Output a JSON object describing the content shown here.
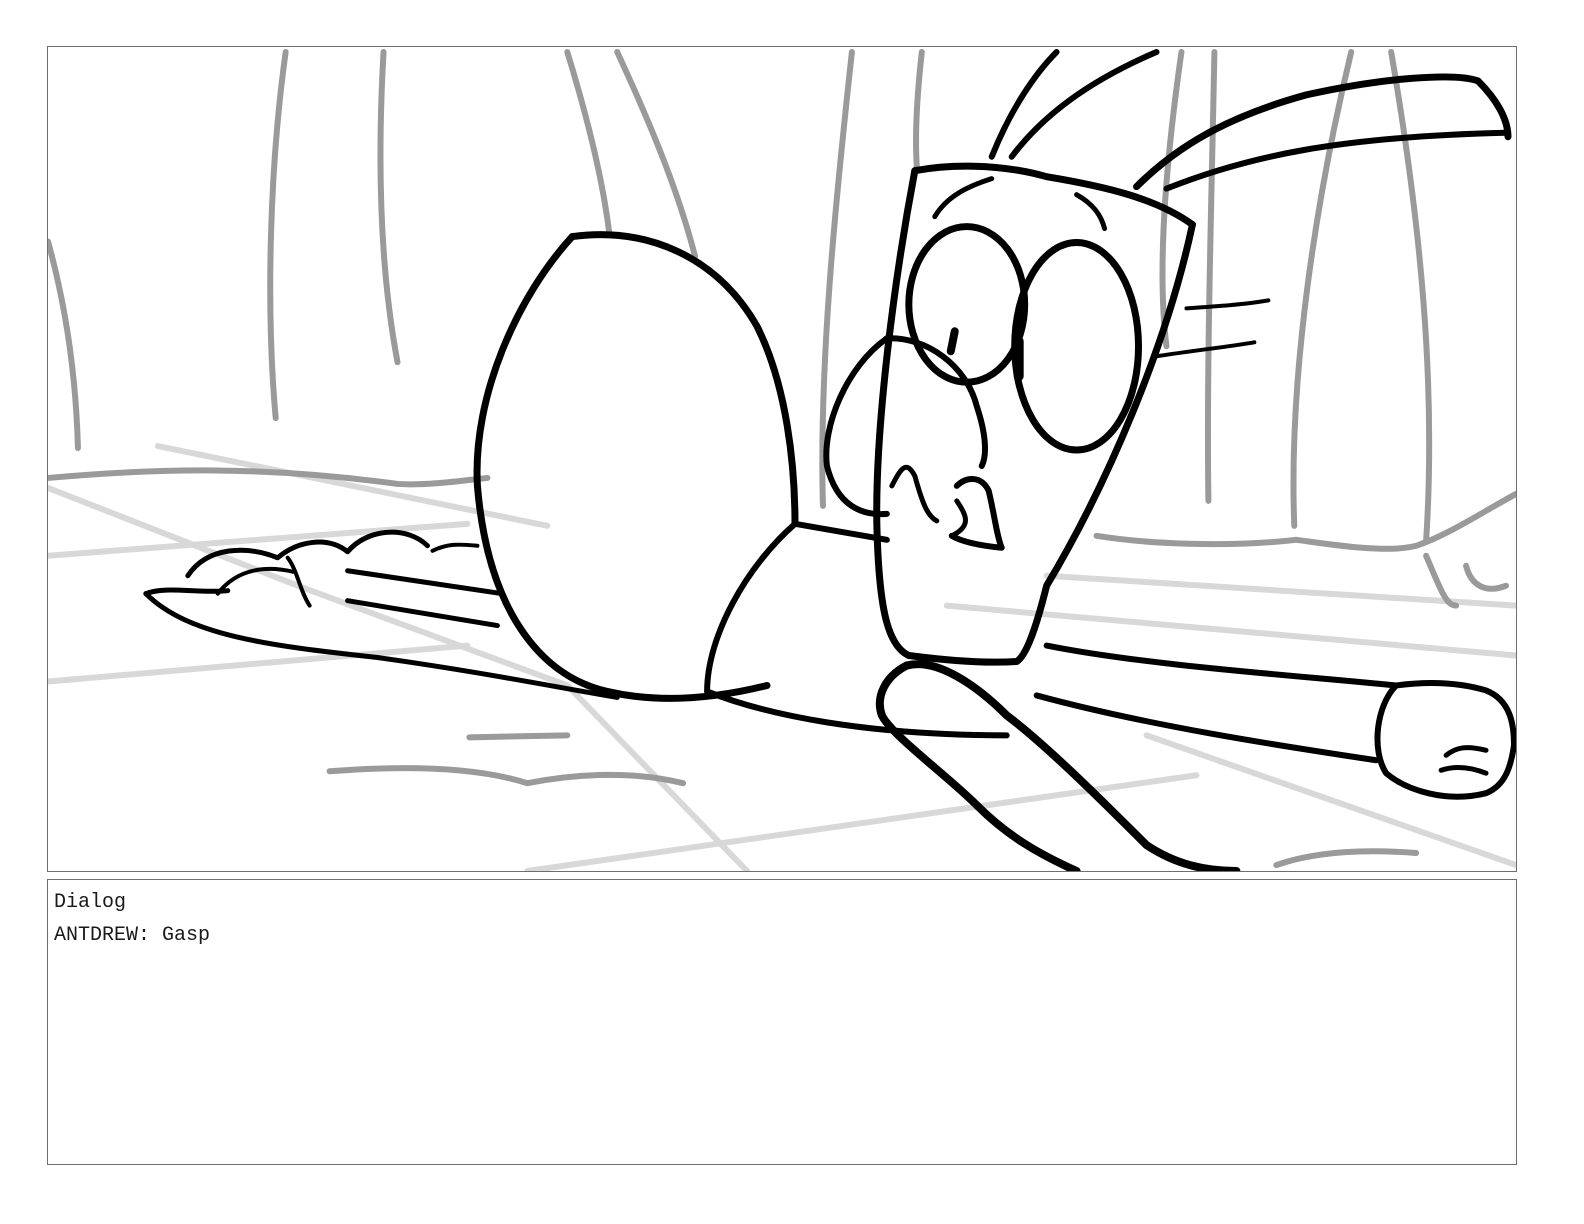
{
  "notes": {
    "heading": "Dialog",
    "dialog_line": "ANTDREW: Gasp"
  },
  "colors": {
    "ink": "#000000",
    "background_sketch": "#9a9a9a",
    "ground_lines": "#d8d8d8",
    "border": "#6e6e6e",
    "text": "#1a1a1a"
  }
}
